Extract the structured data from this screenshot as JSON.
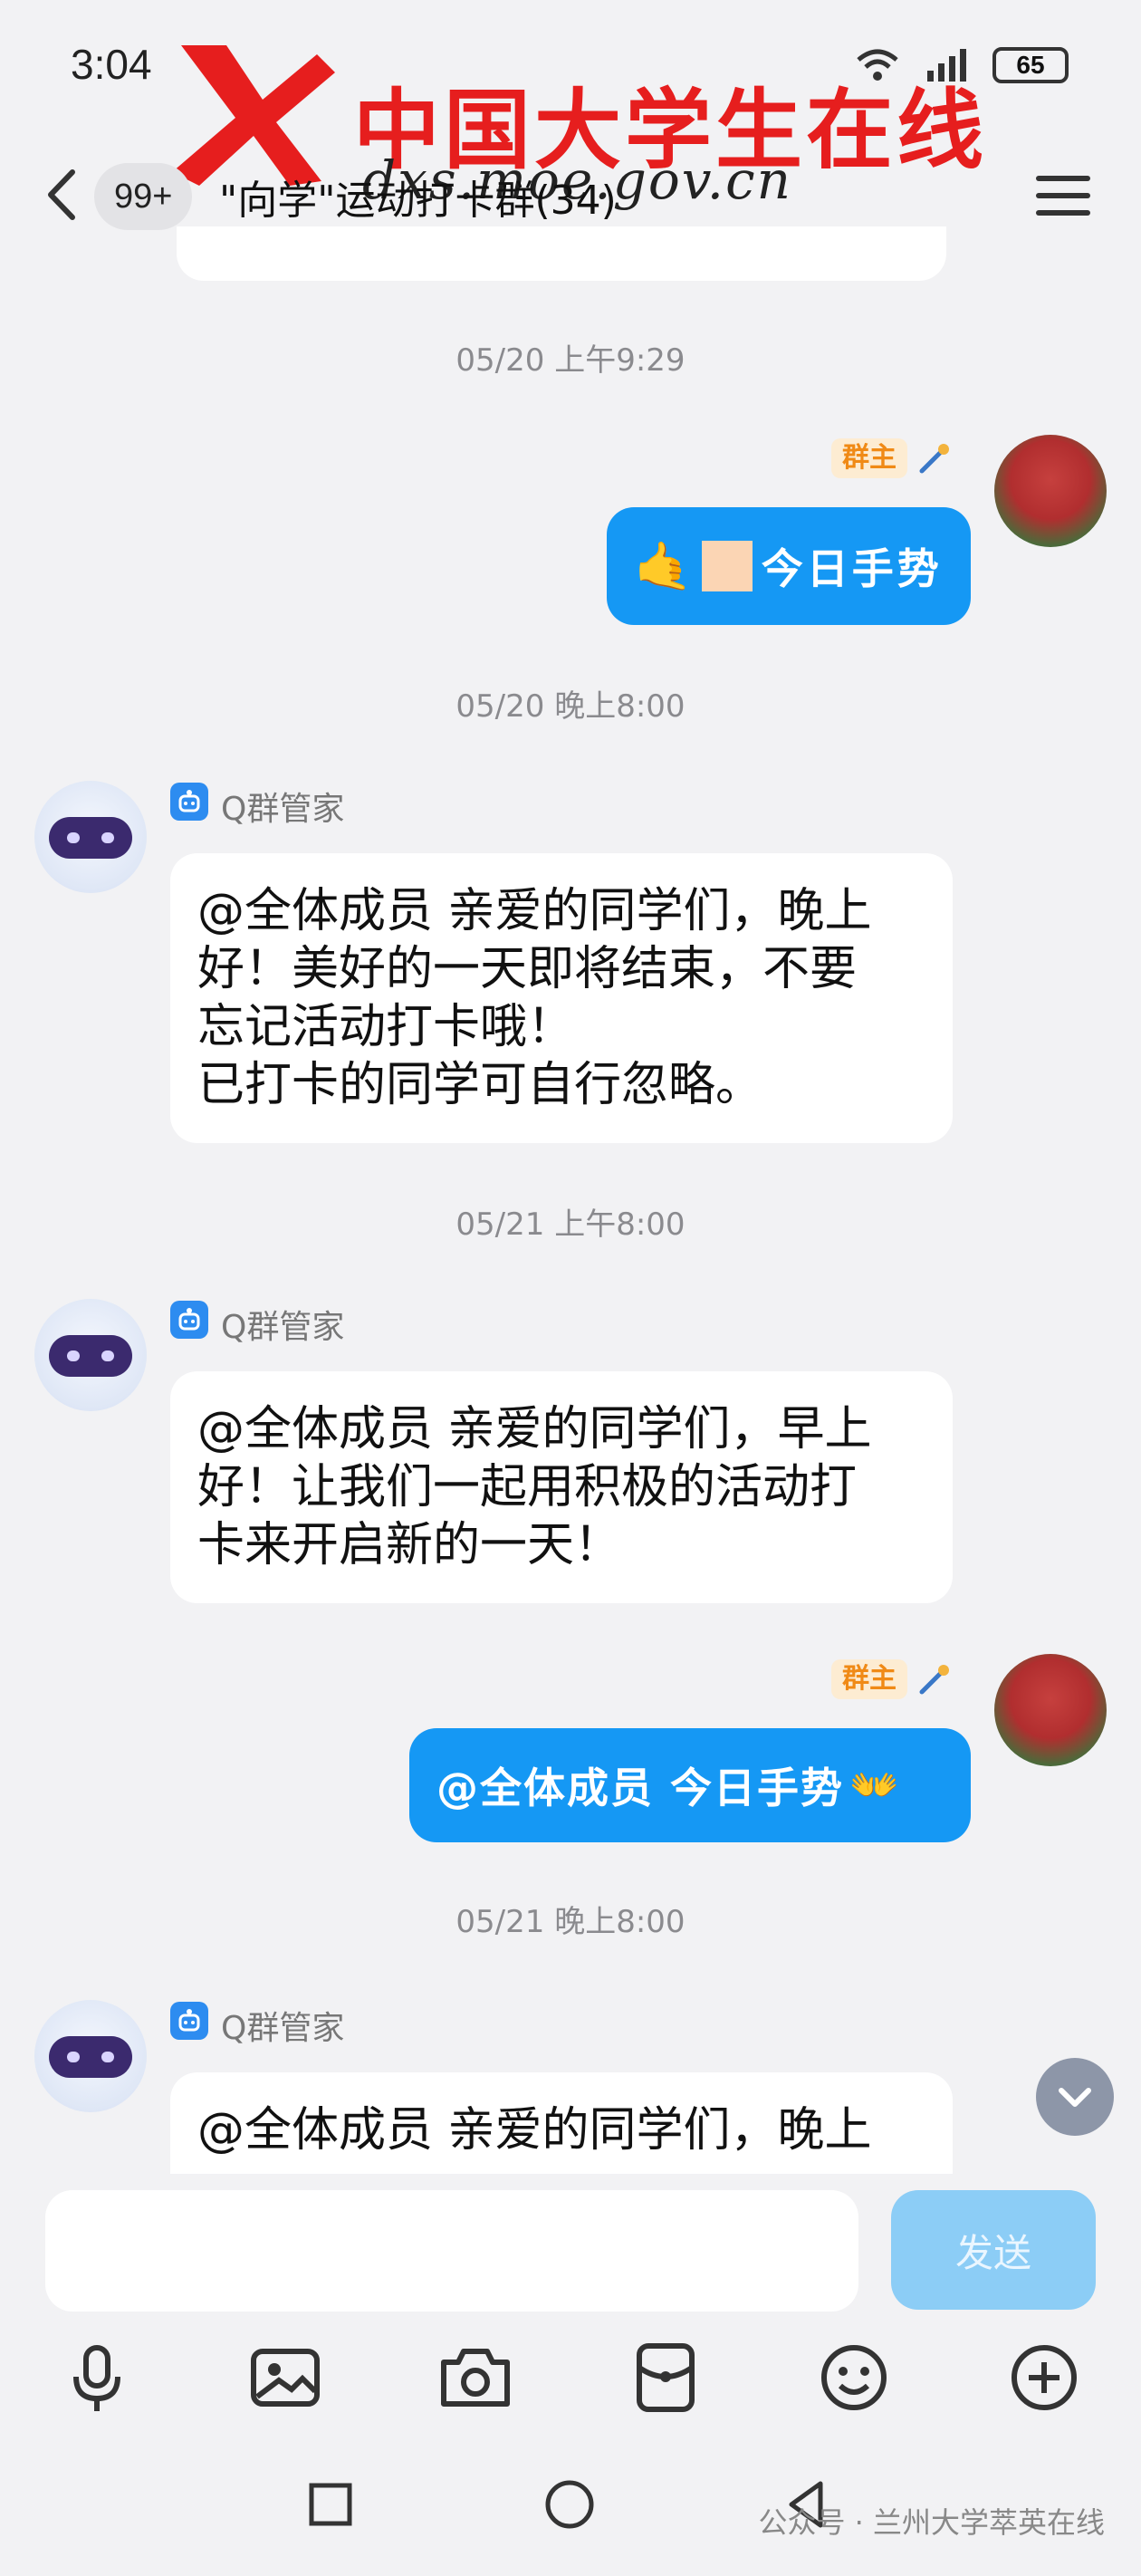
{
  "status": {
    "time": "3:04",
    "battery": "65"
  },
  "watermark": {
    "title": "中国大学生在线",
    "url": "dxs.moe.gov.cn"
  },
  "header": {
    "badge": "99+",
    "title": "\"向学\"运动打卡群(34)"
  },
  "messages": [
    {
      "timestamp": "05/20 上午9:29",
      "owner_tag": "群主",
      "text": "今日手势"
    },
    {
      "timestamp": "05/20 晚上8:00",
      "sender": "Q群管家",
      "lines": [
        "@全体成员 亲爱的同学们，晚上",
        "好！美好的一天即将结束，不要",
        "忘记活动打卡哦！",
        "已打卡的同学可自行忽略。"
      ]
    },
    {
      "timestamp": "05/21 上午8:00",
      "sender": "Q群管家",
      "lines": [
        "@全体成员 亲爱的同学们，早上",
        "好！让我们一起用积极的活动打",
        "卡来开启新的一天！"
      ]
    },
    {
      "owner_tag": "群主",
      "text": "@全体成员 今日手势"
    },
    {
      "timestamp": "05/21 晚上8:00",
      "sender": "Q群管家",
      "lines": [
        "@全体成员 亲爱的同学们，晚上"
      ]
    }
  ],
  "input": {
    "placeholder": "",
    "send_label": "发送"
  },
  "toolbar": [
    "microphone-icon",
    "image-icon",
    "camera-icon",
    "red-packet-icon",
    "emoji-icon",
    "plus-icon"
  ],
  "footer": {
    "watermark": "公众号 · 兰州大学萃英在线"
  },
  "colors": {
    "accent": "#1598f4",
    "owner_tag": "#f08a16",
    "send_disabled": "#8ccdf6"
  }
}
